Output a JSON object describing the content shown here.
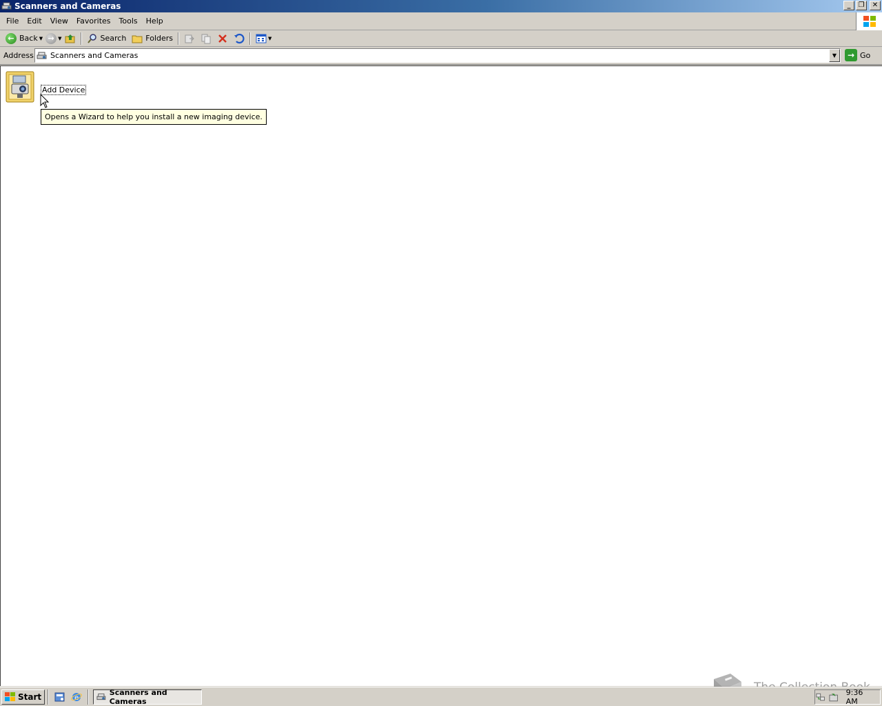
{
  "window": {
    "title": "Scanners and Cameras"
  },
  "window_buttons": {
    "minimize": "_",
    "restore": "❐",
    "close": "✕"
  },
  "menu": {
    "items": [
      {
        "label": "File",
        "accel": "F"
      },
      {
        "label": "Edit",
        "accel": "E"
      },
      {
        "label": "View",
        "accel": "V"
      },
      {
        "label": "Favorites",
        "accel": "a"
      },
      {
        "label": "Tools",
        "accel": "T"
      },
      {
        "label": "Help",
        "accel": "H"
      }
    ]
  },
  "toolbar": {
    "back_label": "Back",
    "search_label": "Search",
    "folders_label": "Folders"
  },
  "address": {
    "label": "Address",
    "value": "Scanners and Cameras",
    "go_label": "Go"
  },
  "content": {
    "items": [
      {
        "label": "Add Device"
      }
    ],
    "tooltip": "Opens a Wizard to help you install a new imaging device."
  },
  "taskbar": {
    "start_label": "Start",
    "task_label": "Scanners and Cameras",
    "clock": "9:36 AM"
  },
  "watermark": {
    "text": "The Collection Book"
  }
}
